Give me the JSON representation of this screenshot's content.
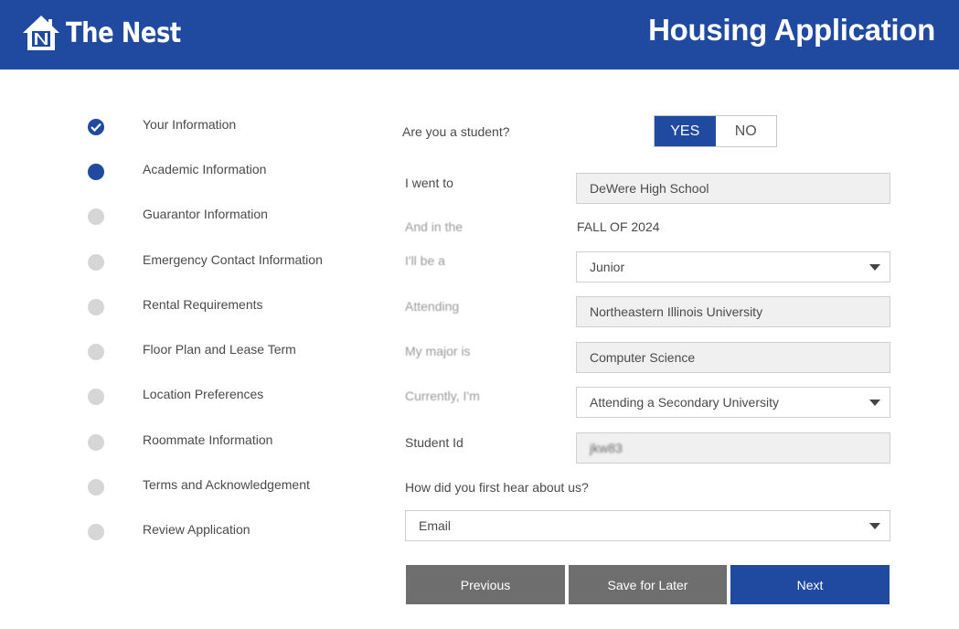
{
  "header": {
    "brand": "The Nest",
    "logo_icon": "house-logo-icon",
    "title": "Housing Application"
  },
  "colors": {
    "brand_blue": "#1f4aa0",
    "button_gray": "#6e6e6e",
    "inactive_dot": "#d6d6d6"
  },
  "steps": [
    {
      "label": "Your Information",
      "status": "completed",
      "icon": "check-icon"
    },
    {
      "label": "Academic Information",
      "status": "current"
    },
    {
      "label": "Guarantor Information",
      "status": "pending"
    },
    {
      "label": "Emergency Contact Information",
      "status": "pending"
    },
    {
      "label": "Rental Requirements",
      "status": "pending"
    },
    {
      "label": "Floor Plan and Lease Term",
      "status": "pending"
    },
    {
      "label": "Location Preferences",
      "status": "pending"
    },
    {
      "label": "Roommate Information",
      "status": "pending"
    },
    {
      "label": "Terms and Acknowledgement",
      "status": "pending"
    },
    {
      "label": "Review Application",
      "status": "pending"
    }
  ],
  "form": {
    "student_question": "Are you a student?",
    "student_yes": "YES",
    "student_no": "NO",
    "student_selected": "YES",
    "went_to_label": "I went to",
    "went_to_value": "DeWere High School",
    "and_in_the_label": "And in the",
    "and_in_the_value": "FALL OF 2024",
    "ill_be_label": "I'll be a",
    "ill_be_value": "Junior",
    "attending_label": "Attending",
    "attending_value": "Northeastern Illinois University",
    "major_label": "My major is",
    "major_value": "Computer Science",
    "currently_label": "Currently, I'm",
    "currently_value": "Attending a Secondary University",
    "student_id_label": "Student Id",
    "student_id_value": "jkw83",
    "hear_label": "How did you first hear about us?",
    "hear_value": "Email"
  },
  "buttons": {
    "previous": "Previous",
    "save": "Save for Later",
    "next": "Next"
  }
}
